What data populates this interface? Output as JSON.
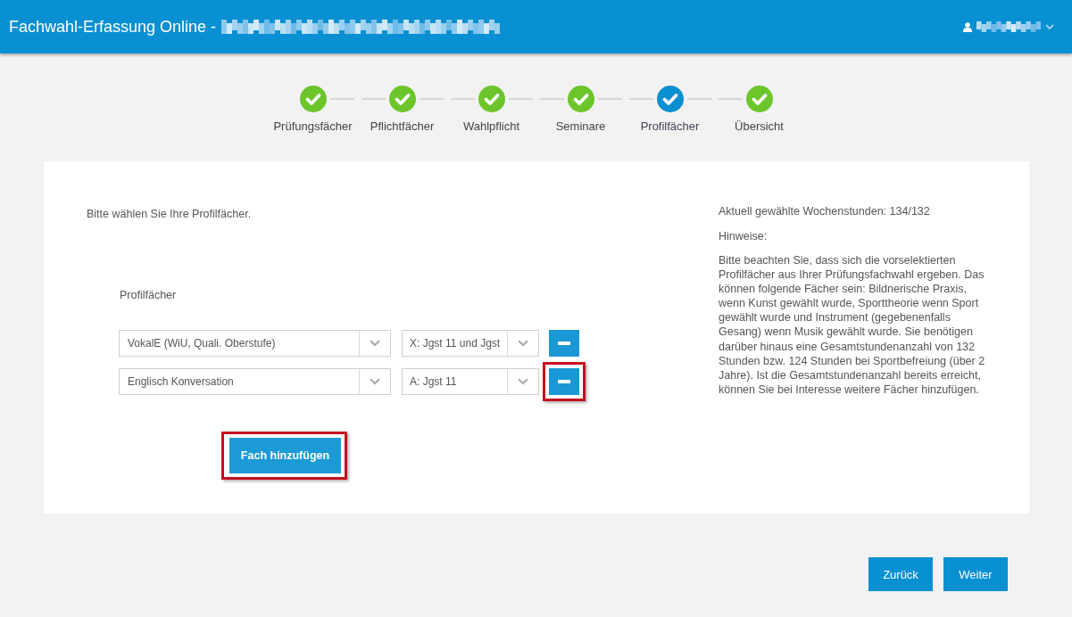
{
  "header": {
    "title": "Fachwahl-Erfassung Online -"
  },
  "steps": [
    {
      "label": "Prüfungsfächer",
      "selected": false
    },
    {
      "label": "Pflichtfächer",
      "selected": false
    },
    {
      "label": "Wahlpflicht",
      "selected": false
    },
    {
      "label": "Seminare",
      "selected": false
    },
    {
      "label": "Profilfächer",
      "selected": true
    },
    {
      "label": "Übersicht",
      "selected": false
    }
  ],
  "instruction": "Bitte wählen Sie Ihre Profilfächer.",
  "profile_section": {
    "label": "Profilfächer",
    "rows": [
      {
        "subject": "VokalE (WiU, Quali. Oberstufe)",
        "period": "X: Jgst 11 und Jgst",
        "highlighted": false
      },
      {
        "subject": "Englisch Konversation",
        "period": "A: Jgst 11",
        "highlighted": true
      }
    ]
  },
  "add_button": {
    "label": "Fach hinzufügen",
    "highlighted": true
  },
  "info": {
    "hours": "Aktuell gewählte Wochenstunden: 134/132",
    "notes_heading": "Hinweise:",
    "notes": "Bitte beachten Sie, dass sich die vorselektierten Profilfächer aus Ihrer Prüfungsfachwahl ergeben. Das können folgende Fächer sein: Bildnerische Praxis, wenn Kunst gewählt wurde, Sporttheorie wenn Sport gewählt wurde und Instrument (gegebenenfalls Gesang) wenn Musik gewählt wurde. Sie benötigen darüber hinaus eine Gesamtstundenanzahl von 132 Stunden bzw. 124 Stunden bei Sportbefreiung (über 2 Jahre). Ist die Gesamtstundenanzahl bereits erreicht, können Sie bei Interesse weitere Fächer hinzufügen."
  },
  "nav_buttons": [
    {
      "label": "Zurück"
    },
    {
      "label": "Weiter"
    }
  ]
}
